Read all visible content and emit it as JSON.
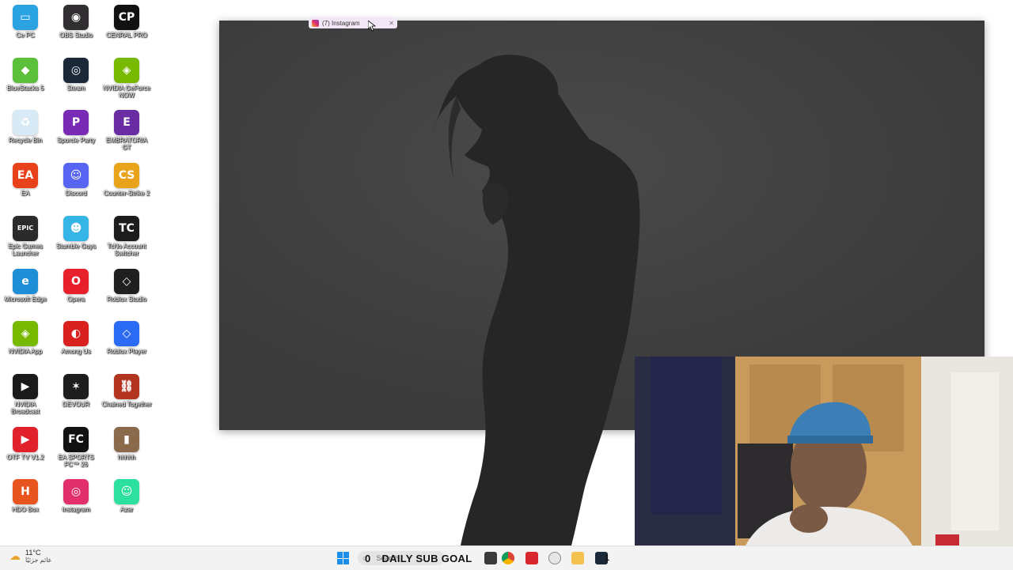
{
  "desktop": {
    "icons": [
      {
        "label": "Ce PC",
        "icon": "pc-icon",
        "color": "#2aa3e0",
        "glyph": "▭"
      },
      {
        "label": "OBS Studio",
        "icon": "obs-icon",
        "color": "#302e31",
        "glyph": "◉"
      },
      {
        "label": "CENRAL PRO",
        "icon": "cenral-pro-icon",
        "color": "#111111",
        "glyph": "CP"
      },
      {
        "label": "BlueStacks 5",
        "icon": "bluestacks-icon",
        "color": "#5bbf3a",
        "glyph": "◆"
      },
      {
        "label": "Steam",
        "icon": "steam-icon",
        "color": "#1b2838",
        "glyph": "◎"
      },
      {
        "label": "NVIDIA GeForce NOW",
        "icon": "geforce-now-icon",
        "color": "#76b900",
        "glyph": "◈"
      },
      {
        "label": "Recycle Bin",
        "icon": "recycle-bin-icon",
        "color": "#d7eaf5",
        "glyph": "♻"
      },
      {
        "label": "Sporcle Party",
        "icon": "sporcle-party-icon",
        "color": "#7a2bb5",
        "glyph": "P"
      },
      {
        "label": "EMBRATORIA GT",
        "icon": "embratoria-icon",
        "color": "#6a2ca3",
        "glyph": "E"
      },
      {
        "label": "EA",
        "icon": "ea-icon",
        "color": "#e8421d",
        "glyph": "EA"
      },
      {
        "label": "Discord",
        "icon": "discord-icon",
        "color": "#5865f2",
        "glyph": "☺"
      },
      {
        "label": "Counter-Strike 2",
        "icon": "counter-strike-icon",
        "color": "#e9a31b",
        "glyph": "CS"
      },
      {
        "label": "Epic Games Launcher",
        "icon": "epic-games-icon",
        "color": "#2a2a2a",
        "glyph": "EPIC"
      },
      {
        "label": "Stumble Guys",
        "icon": "stumble-guys-icon",
        "color": "#35b5e5",
        "glyph": "☻"
      },
      {
        "label": "TcNo Account Switcher",
        "icon": "tcno-icon",
        "color": "#1c1c1c",
        "glyph": "TC"
      },
      {
        "label": "Microsoft Edge",
        "icon": "edge-icon",
        "color": "#1e8fd6",
        "glyph": "e"
      },
      {
        "label": "Opera",
        "icon": "opera-icon",
        "color": "#e8202c",
        "glyph": "O"
      },
      {
        "label": "Roblox Studio",
        "icon": "roblox-studio-icon",
        "color": "#1f1f1f",
        "glyph": "◇"
      },
      {
        "label": "NVIDIA App",
        "icon": "nvidia-app-icon",
        "color": "#76b900",
        "glyph": "◈"
      },
      {
        "label": "Among Us",
        "icon": "among-us-icon",
        "color": "#d8201f",
        "glyph": "◐"
      },
      {
        "label": "Roblox Player",
        "icon": "roblox-player-icon",
        "color": "#2b6af2",
        "glyph": "◇"
      },
      {
        "label": "NVIDIA Broadcast",
        "icon": "nvidia-broadcast-icon",
        "color": "#1a1a1a",
        "glyph": "▶"
      },
      {
        "label": "DEVOUR",
        "icon": "devour-icon",
        "color": "#1d1d1d",
        "glyph": "✶"
      },
      {
        "label": "Chained Together",
        "icon": "chained-together-icon",
        "color": "#b2331f",
        "glyph": "⛓"
      },
      {
        "label": "OTF TV V1.2",
        "icon": "otf-tv-icon",
        "color": "#e0202a",
        "glyph": "▶"
      },
      {
        "label": "EA SPORTS FC™ 26",
        "icon": "ea-fc-icon",
        "color": "#111111",
        "glyph": "FC"
      },
      {
        "label": "hhhhh",
        "icon": "hhhhh-file-icon",
        "color": "#8a6a4a",
        "glyph": "▮"
      },
      {
        "label": "HDO Box",
        "icon": "hdo-box-icon",
        "color": "#e8541d",
        "glyph": "H"
      },
      {
        "label": "Instagram",
        "icon": "instagram-icon",
        "color": "#e1306c",
        "glyph": "◎"
      },
      {
        "label": "Azar",
        "icon": "azar-icon",
        "color": "#2de0a0",
        "glyph": "☺"
      }
    ]
  },
  "window": {
    "tab_title": "(7) Instagram",
    "close_glyph": "✕"
  },
  "taskbar": {
    "weather_temp": "11°C",
    "weather_desc": "غائم جزئيًا",
    "search_placeholder": "Search",
    "sub_goal_count": "0",
    "sub_goal_label": "DAILY SUB GOAL",
    "notification_count": "1"
  }
}
